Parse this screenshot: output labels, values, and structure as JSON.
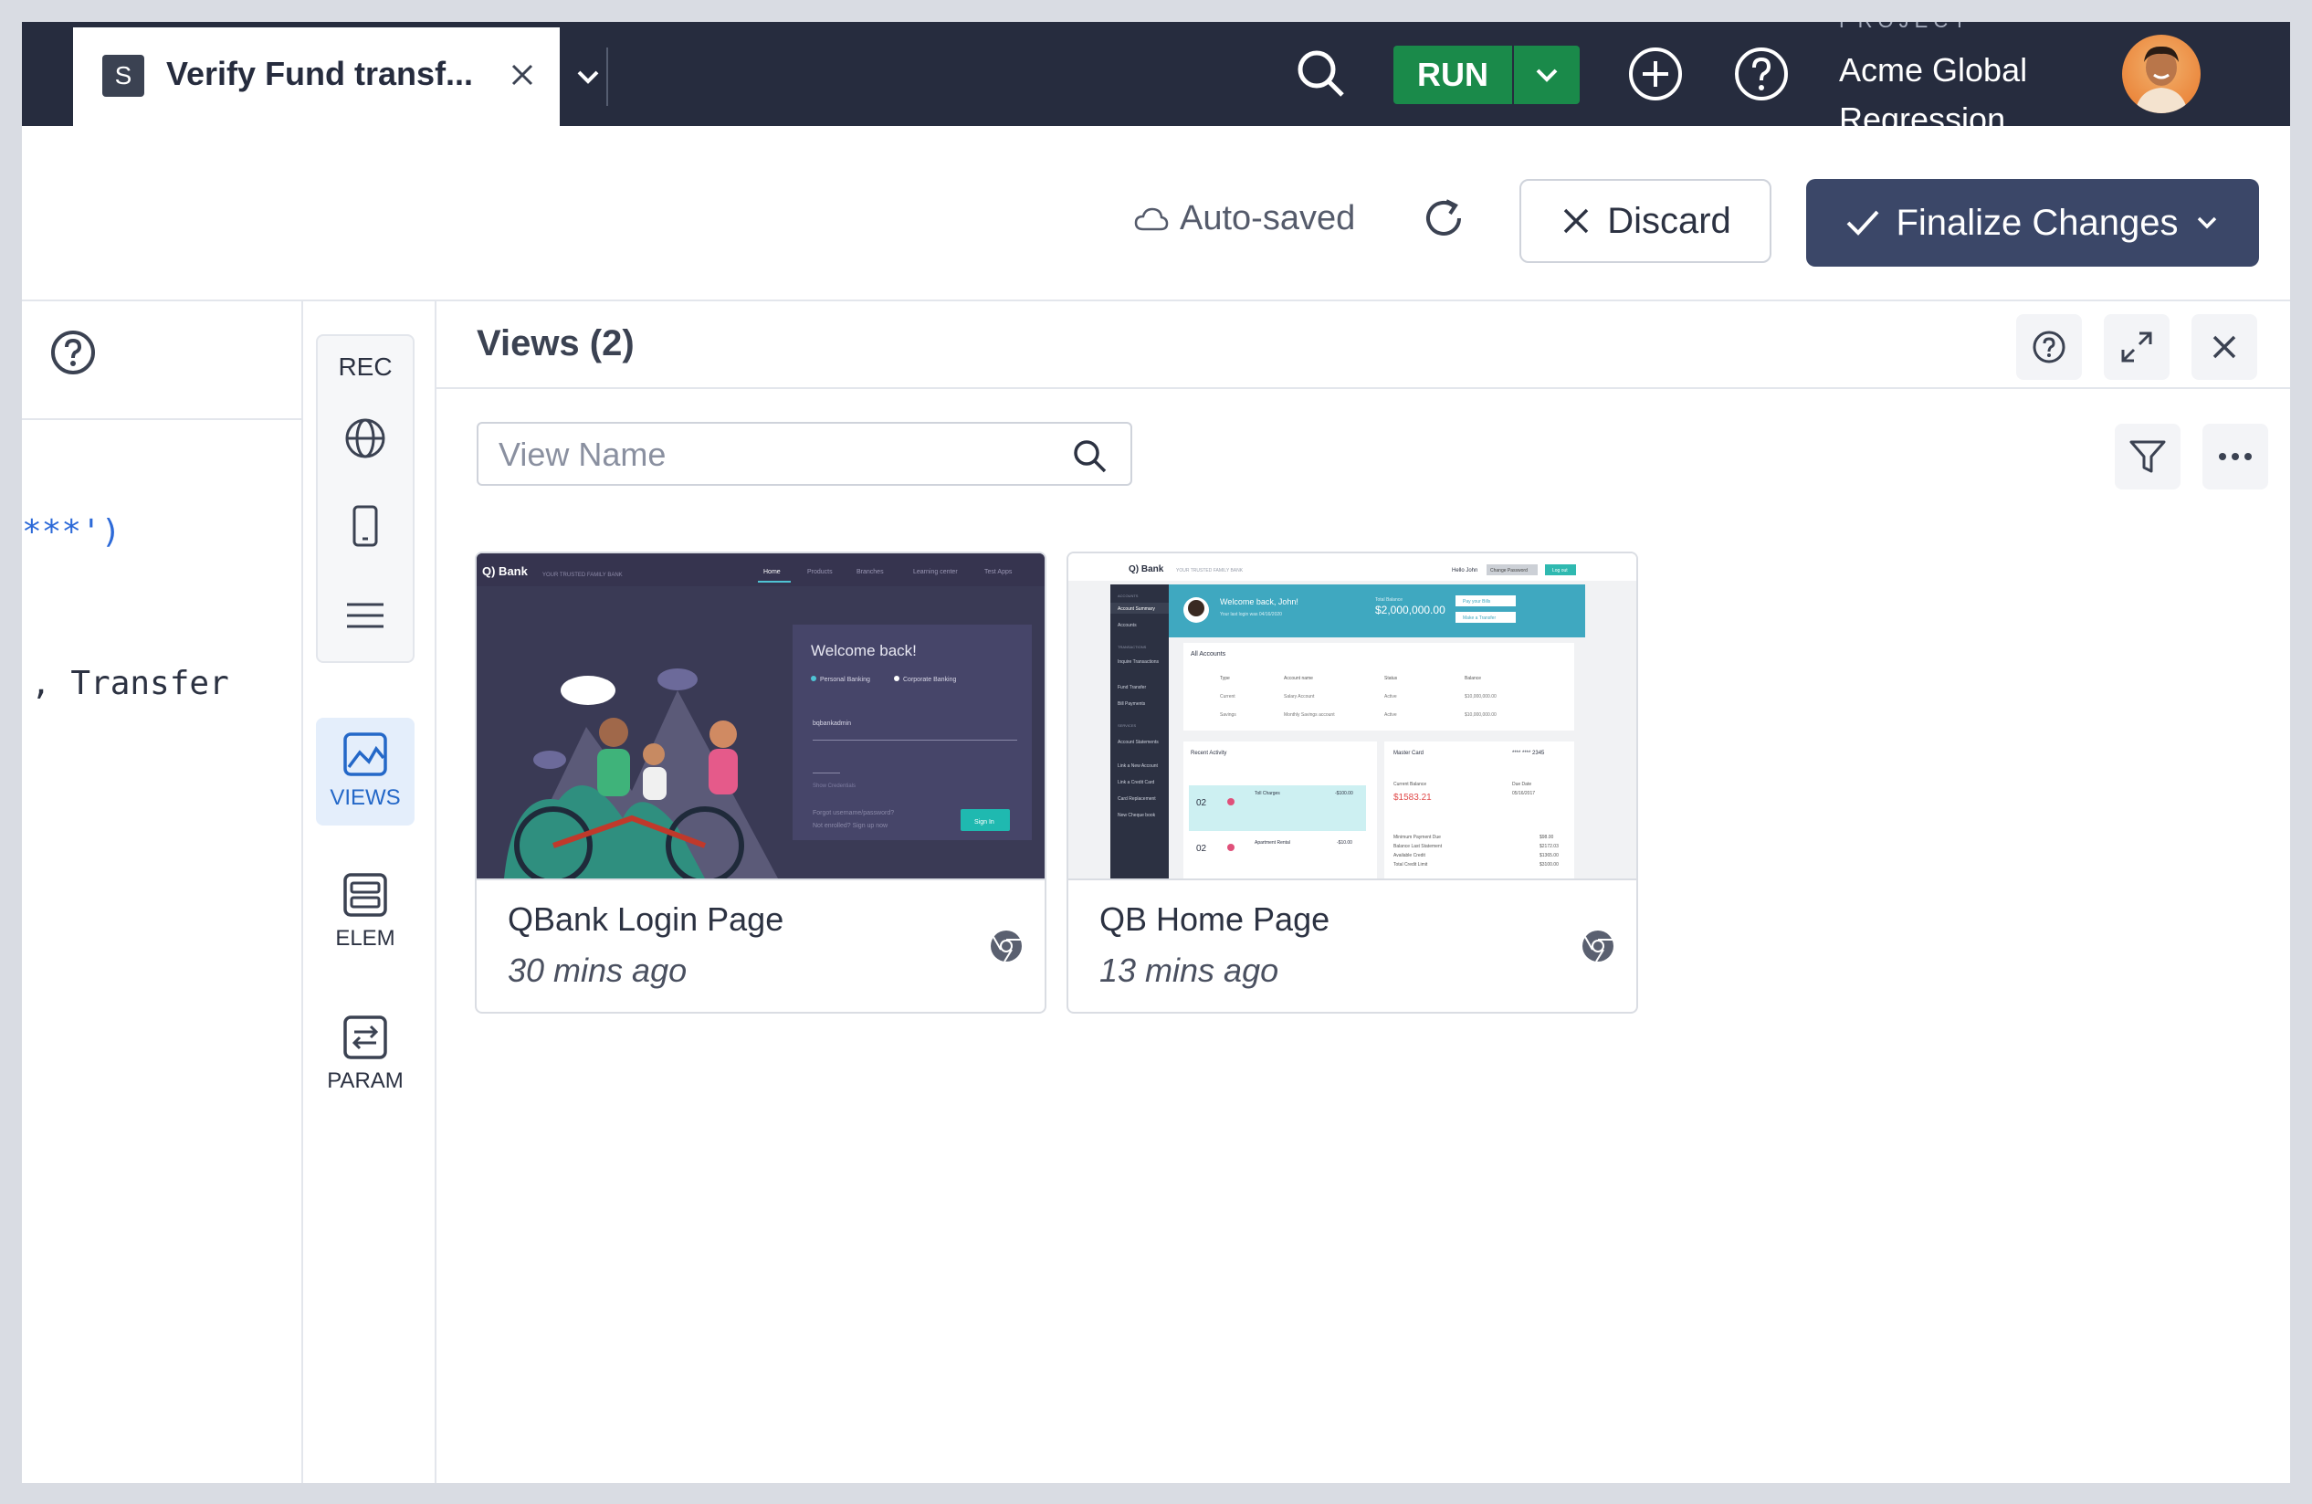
{
  "tab": {
    "badge": "S",
    "title": "Verify Fund transf..."
  },
  "topbar": {
    "run_label": "RUN",
    "project_label": "PROJECT",
    "project_name": "Acme Global Regression"
  },
  "actions": {
    "autosave": "Auto-saved",
    "discard": "Discard",
    "finalize": "Finalize Changes"
  },
  "editor": {
    "code_line_1": "***')",
    "code_line_2": ", Transfer"
  },
  "rail": {
    "rec": "REC",
    "views": "VIEWS",
    "elem": "ELEM",
    "param": "PARAM"
  },
  "views": {
    "title": "Views (2)",
    "search_placeholder": "View Name",
    "cards": [
      {
        "name": "QBank Login Page",
        "time": "30 mins ago"
      },
      {
        "name": "QB Home Page",
        "time": "13 mins ago"
      }
    ]
  },
  "colors": {
    "topbar": "#262c3e",
    "run": "#1a8a4a",
    "finalize": "#3b4768",
    "active_rail": "#2468c8"
  }
}
